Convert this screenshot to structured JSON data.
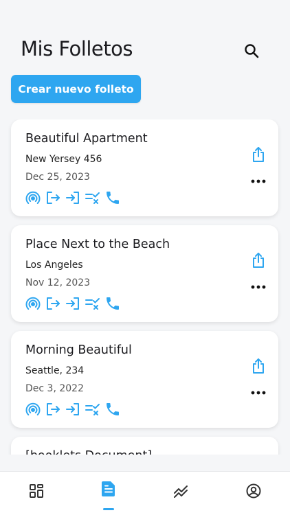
{
  "header": {
    "title": "Mis Folletos"
  },
  "actions": {
    "create_label": "Crear nuevo folleto"
  },
  "colors": {
    "accent": "#2ea6f0",
    "text": "#1b1b1f",
    "background": "#f5f6f8"
  },
  "cards": [
    {
      "title": "Beautiful Apartment",
      "address": "New Yersey 456",
      "date": "Dec 25, 2023"
    },
    {
      "title": "Place Next to the Beach",
      "address": "Los Angeles",
      "date": "Nov 12, 2023"
    },
    {
      "title": "Morning Beautiful",
      "address": "Seattle, 234",
      "date": "Dec 3, 2022"
    },
    {
      "title": "[booklets Document]",
      "address": "",
      "date": ""
    }
  ],
  "card_icons": [
    "broadcast-icon",
    "logout-icon",
    "login-icon",
    "checklist-cancel-icon",
    "phone-icon",
    "share-icon",
    "more-icon"
  ],
  "tabs": [
    {
      "icon": "dashboard-icon",
      "active": false
    },
    {
      "icon": "document-icon",
      "active": true
    },
    {
      "icon": "trending-icon",
      "active": false
    },
    {
      "icon": "user-icon",
      "active": false
    }
  ]
}
